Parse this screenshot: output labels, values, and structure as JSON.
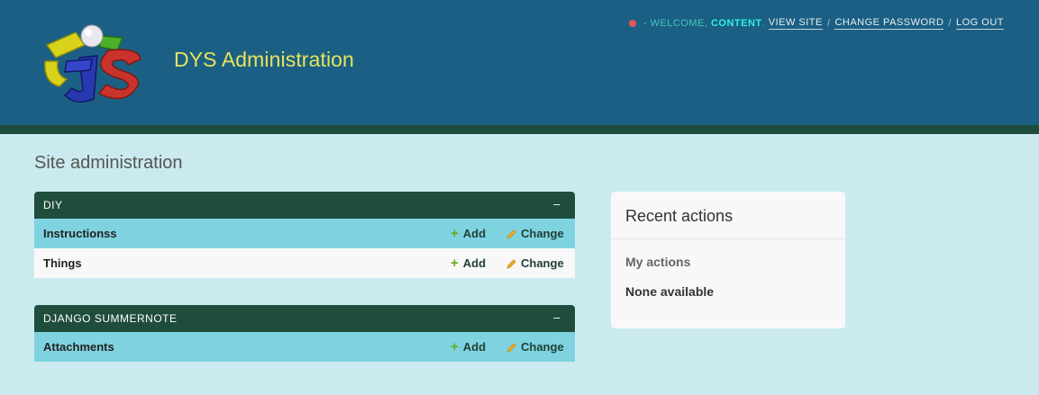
{
  "header": {
    "site_name": "DYS Administration",
    "logo_alt": "logo"
  },
  "user_tools": {
    "welcome": "Welcome,",
    "username": "content",
    "view_site": "View site",
    "change_password": "Change password",
    "log_out": "Log out"
  },
  "page_title": "Site administration",
  "modules": [
    {
      "caption": "DIY",
      "collapse": "–",
      "models": [
        {
          "name": "Instructionss",
          "add": "Add",
          "change": "Change"
        },
        {
          "name": "Things",
          "add": "Add",
          "change": "Change"
        }
      ]
    },
    {
      "caption": "Django Summernote",
      "collapse": "–",
      "models": [
        {
          "name": "Attachments",
          "add": "Add",
          "change": "Change"
        }
      ]
    }
  ],
  "recent_actions": {
    "title": "Recent actions",
    "my_actions": "My actions",
    "none": "None available"
  },
  "colors": {
    "header_bg": "#1b6084",
    "caption_bg": "#1f4d3d",
    "row_alt": "#7fd3e0",
    "brand_text": "#e7e35a",
    "body_bg": "#cbeaf0"
  },
  "icons": {
    "status_dot": "red-dot-icon",
    "add": "plus-icon",
    "change": "pencil-icon"
  }
}
